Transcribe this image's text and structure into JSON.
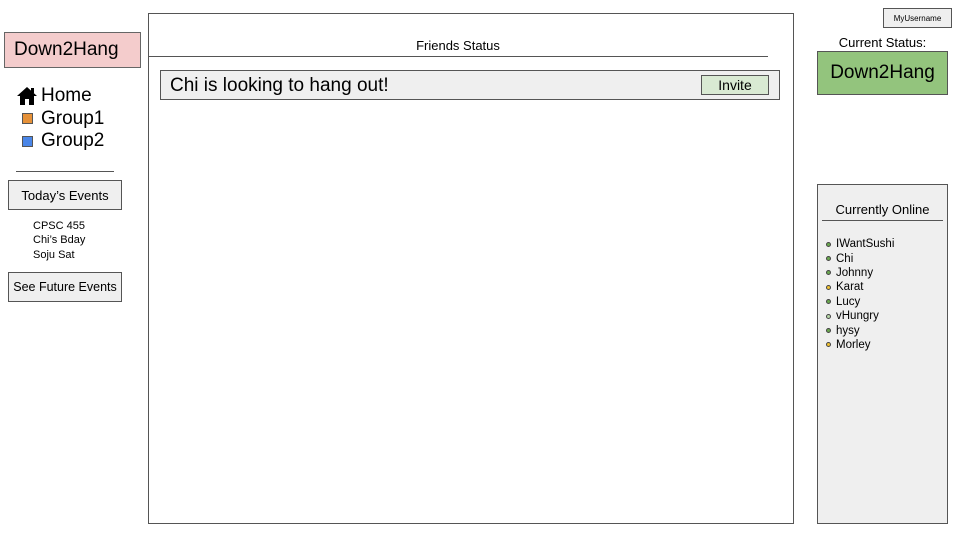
{
  "app": {
    "brand": "Down2Hang"
  },
  "sidebar": {
    "nav": [
      {
        "label": "Home",
        "icon": "home-icon"
      },
      {
        "label": "Group1",
        "icon": "group-swatch",
        "color": "#e69138"
      },
      {
        "label": "Group2",
        "icon": "group-swatch",
        "color": "#4a86e8"
      }
    ],
    "todays_events_label": "Today’s Events",
    "events": [
      "CPSC 455",
      "Chi’s Bday",
      "Soju Sat"
    ],
    "future_events_label": "See Future Events"
  },
  "main": {
    "title": "Friends Status",
    "cards": [
      {
        "text": "Chi is looking to hang out!",
        "action": "Invite"
      }
    ]
  },
  "header": {
    "username": "MyUsername"
  },
  "status": {
    "label": "Current Status:",
    "value": "Down2Hang",
    "color": "#93c47d"
  },
  "online": {
    "title": "Currently Online",
    "users": [
      {
        "name": "IWantSushi",
        "dot_color": "#6aa84f"
      },
      {
        "name": "Chi",
        "dot_color": "#6aa84f"
      },
      {
        "name": "Johnny",
        "dot_color": "#6aa84f"
      },
      {
        "name": "Karat",
        "dot_color": "#f1c232"
      },
      {
        "name": "Lucy",
        "dot_color": "#6aa84f"
      },
      {
        "name": "vHungry",
        "dot_color": "#b6d7a8"
      },
      {
        "name": "hysy",
        "dot_color": "#6aa84f"
      },
      {
        "name": "Morley",
        "dot_color": "#f1c232"
      }
    ]
  },
  "colors": {
    "brand_bg": "#f4cccc",
    "button_bg": "#efefef",
    "invite_bg": "#d9ead3"
  }
}
